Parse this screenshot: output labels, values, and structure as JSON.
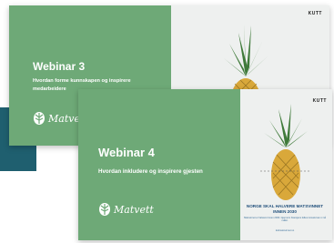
{
  "back_card": {
    "title": "Webinar 3",
    "subtitle": "Hvordan forme kunnskapen og inspirere medarbeidere",
    "logo_text": "Matvett",
    "brand": "KUTT"
  },
  "front_card": {
    "title": "Webinar 4",
    "subtitle": "Hvordan inkludere og inspirere gjesten",
    "logo_text": "Matvett",
    "brand": "KUTT",
    "slogan": "NORGE SKAL HALVERE MATSVINNET INNEN 2030",
    "slogan_sub": "Matsvinnet er halveret innen 2030. Gjennom bransjens felles innsats kan vi nå målet.",
    "slogan_link": "kuttmatsvinnet.no"
  },
  "colors": {
    "panel_green": "#6ea977",
    "teal_band": "#1f5f6f",
    "slogan_blue": "#1f4e7a"
  }
}
